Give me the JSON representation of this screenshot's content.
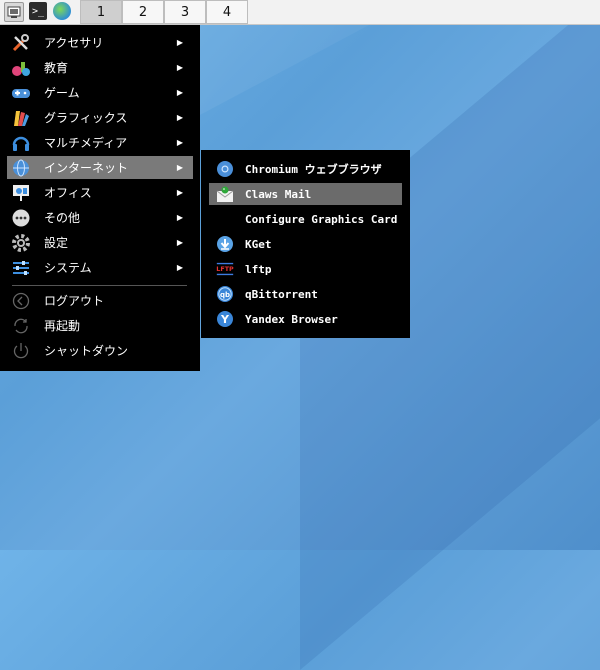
{
  "taskbar": {
    "workspaces": [
      "1",
      "2",
      "3",
      "4"
    ],
    "term_glyph": ">_"
  },
  "main_menu": {
    "items": [
      {
        "label": "アクセサリ",
        "icon": "tools-icon",
        "arrow": "▶"
      },
      {
        "label": "教育",
        "icon": "education-flask-icon",
        "arrow": "▶"
      },
      {
        "label": "ゲーム",
        "icon": "gamepad-icon",
        "arrow": "▶"
      },
      {
        "label": "グラフィックス",
        "icon": "palette-icon",
        "arrow": "▶"
      },
      {
        "label": "マルチメディア",
        "icon": "headphones-icon",
        "arrow": "▶"
      },
      {
        "label": "インターネット",
        "icon": "globe-icon",
        "arrow": "▶",
        "highlighted": true
      },
      {
        "label": "オフィス",
        "icon": "presentation-icon",
        "arrow": "▶"
      },
      {
        "label": "その他",
        "icon": "more-dots-icon",
        "arrow": "▶"
      },
      {
        "label": "設定",
        "icon": "settings-gear-icon",
        "arrow": "▶"
      },
      {
        "label": "システム",
        "icon": "system-sliders-icon",
        "arrow": "▶"
      }
    ],
    "session": [
      {
        "label": "ログアウト",
        "icon": "logout-icon"
      },
      {
        "label": "再起動",
        "icon": "reboot-icon"
      },
      {
        "label": "シャットダウン",
        "icon": "power-icon"
      }
    ]
  },
  "internet_submenu": {
    "items": [
      {
        "label": "Chromium ウェブブラウザ",
        "icon": "chromium-icon"
      },
      {
        "label": "Claws Mail",
        "icon": "claws-mail-icon",
        "highlighted": true
      },
      {
        "label": "Configure Graphics Card",
        "icon": ""
      },
      {
        "label": "KGet",
        "icon": "kget-download-icon"
      },
      {
        "label": "lftp",
        "icon": "lftp-icon",
        "icon_text": "LFTP"
      },
      {
        "label": "qBittorrent",
        "icon": "qbittorrent-icon",
        "icon_text": "qb"
      },
      {
        "label": "Yandex Browser",
        "icon": "yandex-browser-icon",
        "icon_text": "Y"
      }
    ]
  },
  "colors": {
    "menu_bg": "#000000",
    "highlight": "#7a7a7a",
    "taskbar_bg": "#f2f2f2"
  }
}
